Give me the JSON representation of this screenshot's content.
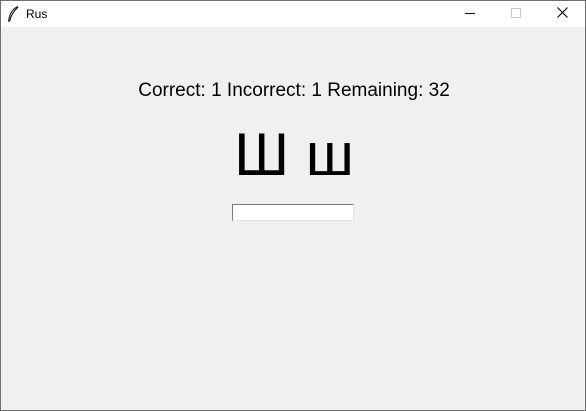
{
  "window": {
    "title": "Rus",
    "icon": "feather-icon",
    "controls": {
      "minimize": "minimize-icon",
      "maximize": "maximize-icon",
      "close": "close-icon"
    }
  },
  "quiz": {
    "stats_text": "Correct: 1 Incorrect: 1 Remaining: 32",
    "letter_text": "Ш ш",
    "answer_value": "",
    "answer_placeholder": ""
  }
}
